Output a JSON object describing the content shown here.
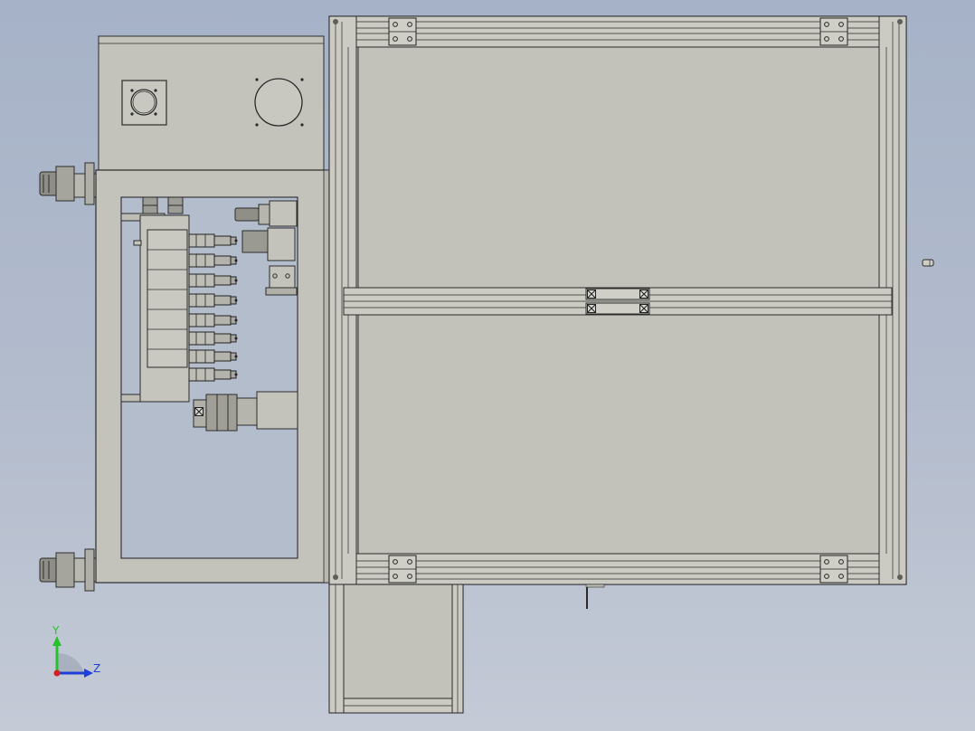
{
  "viewport": {
    "background_top": "#a6b2c7",
    "background_bottom": "#c4cad6",
    "part_fill": "#c2c2ba",
    "line_color": "#2b2b2b"
  },
  "triad": {
    "y_label": "Y",
    "z_label": "Z",
    "y_color": "#27c22b",
    "z_color": "#1e3fd8",
    "origin_color": "#d42020"
  }
}
